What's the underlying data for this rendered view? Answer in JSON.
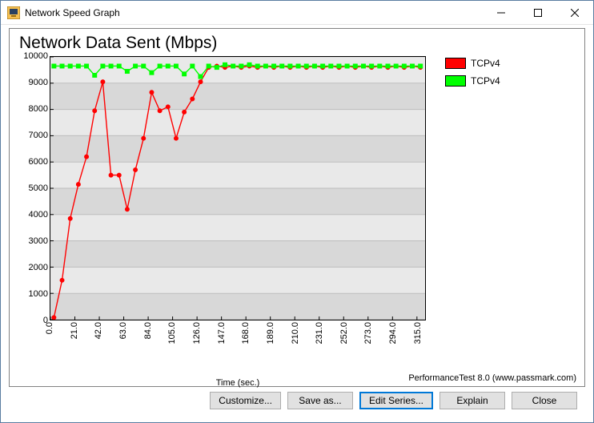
{
  "window": {
    "title": "Network Speed Graph",
    "buttons": {
      "minimize": "—",
      "maximize": "☐",
      "close": "✕"
    }
  },
  "credit": "PerformanceTest 8.0 (www.passmark.com)",
  "buttons": {
    "customize": "Customize...",
    "save_as": "Save as...",
    "edit_series": "Edit Series...",
    "explain": "Explain",
    "close": "Close"
  },
  "legend": [
    {
      "label": "TCPv4",
      "color": "#ff0000"
    },
    {
      "label": "TCPv4",
      "color": "#00ff00"
    }
  ],
  "chart_data": {
    "type": "line",
    "title": "Network Data Sent (Mbps)",
    "xlabel": "Time (sec.)",
    "ylabel": "",
    "xlim": [
      0,
      322
    ],
    "ylim": [
      0,
      10000
    ],
    "xticks": [
      0.0,
      21.0,
      42.0,
      63.0,
      84.0,
      105.0,
      126.0,
      147.0,
      168.0,
      189.0,
      210.0,
      231.0,
      252.0,
      273.0,
      294.0,
      315.0
    ],
    "yticks": [
      0,
      1000,
      2000,
      3000,
      4000,
      5000,
      6000,
      7000,
      8000,
      9000,
      10000
    ],
    "stripe_bands": 10,
    "series": [
      {
        "name": "TCPv4",
        "color": "#ff0000",
        "marker": "circle",
        "x": [
          3,
          10,
          17,
          24,
          31,
          38,
          45,
          52,
          59,
          66,
          73,
          80,
          87,
          94,
          101,
          108,
          115,
          122,
          129,
          136,
          143,
          150,
          157,
          164,
          171,
          178,
          185,
          192,
          199,
          206,
          213,
          220,
          227,
          234,
          241,
          248,
          255,
          262,
          269,
          276,
          283,
          290,
          297,
          304,
          311,
          318
        ],
        "y": [
          80,
          1500,
          3850,
          5150,
          6200,
          7950,
          9050,
          5500,
          5500,
          4200,
          5700,
          6900,
          8650,
          7950,
          8100,
          6900,
          7900,
          8400,
          9050,
          9600,
          9650,
          9600,
          9650,
          9600,
          9650,
          9600,
          9650,
          9600,
          9650,
          9600,
          9650,
          9600,
          9650,
          9600,
          9650,
          9600,
          9650,
          9600,
          9650,
          9600,
          9650,
          9600,
          9650,
          9600,
          9650,
          9600
        ]
      },
      {
        "name": "TCPv4",
        "color": "#00ff00",
        "marker": "square",
        "x": [
          3,
          10,
          17,
          24,
          31,
          38,
          45,
          52,
          59,
          66,
          73,
          80,
          87,
          94,
          101,
          108,
          115,
          122,
          129,
          136,
          143,
          150,
          157,
          164,
          171,
          178,
          185,
          192,
          199,
          206,
          213,
          220,
          227,
          234,
          241,
          248,
          255,
          262,
          269,
          276,
          283,
          290,
          297,
          304,
          311,
          318
        ],
        "y": [
          9650,
          9650,
          9650,
          9650,
          9650,
          9300,
          9650,
          9650,
          9650,
          9450,
          9650,
          9650,
          9400,
          9650,
          9650,
          9650,
          9350,
          9650,
          9250,
          9650,
          9600,
          9700,
          9650,
          9650,
          9700,
          9650,
          9650,
          9650,
          9650,
          9650,
          9650,
          9650,
          9650,
          9650,
          9650,
          9650,
          9650,
          9650,
          9650,
          9650,
          9650,
          9650,
          9650,
          9650,
          9650,
          9650
        ]
      }
    ]
  }
}
